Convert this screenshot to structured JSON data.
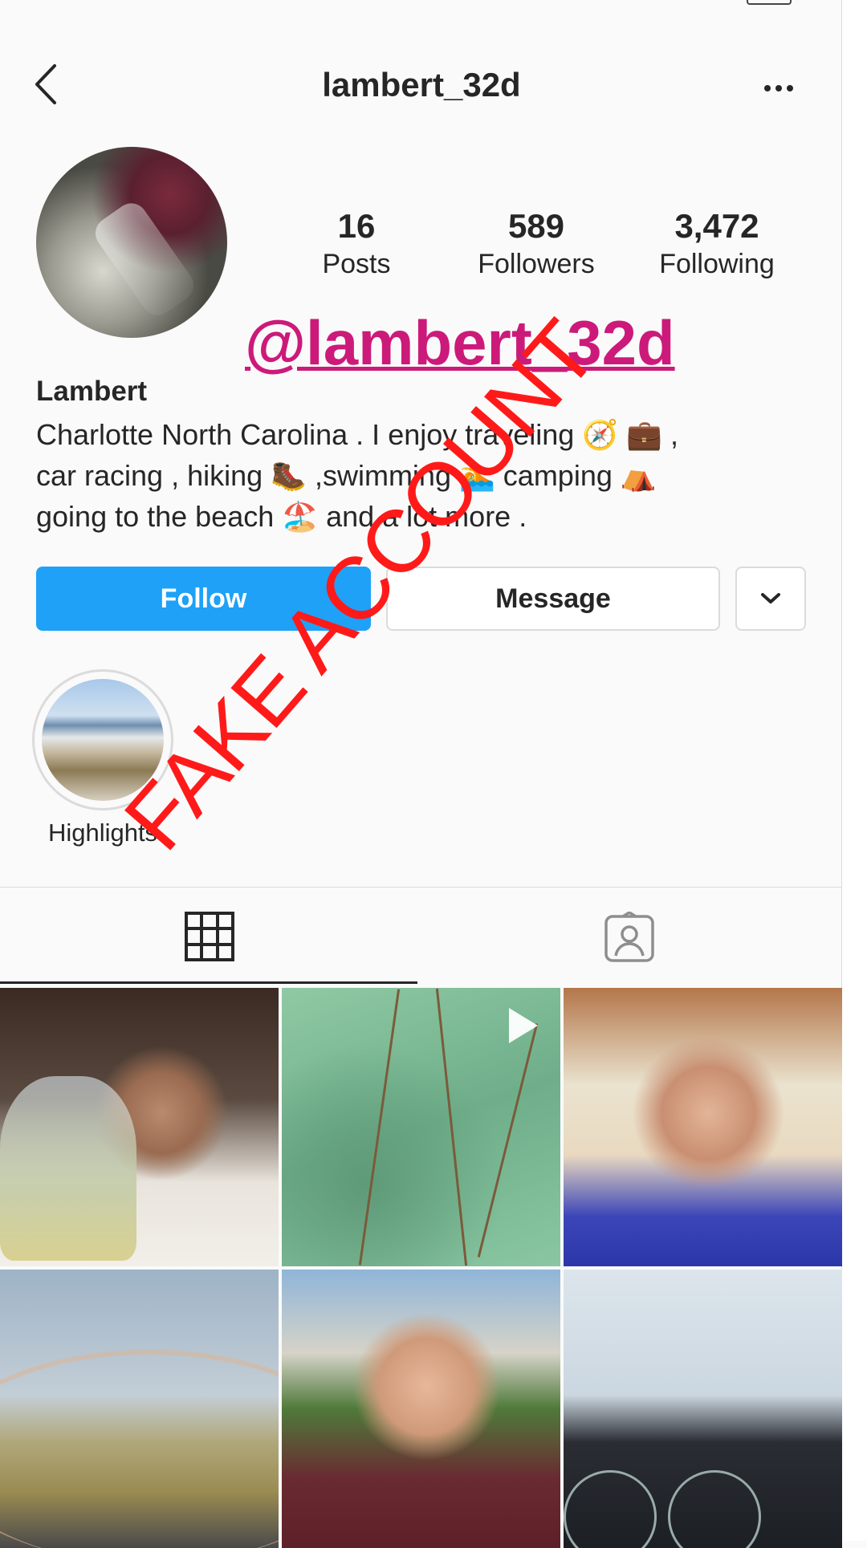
{
  "header": {
    "username": "lambert_32d"
  },
  "profile": {
    "stats": [
      {
        "value": "16",
        "label": "Posts"
      },
      {
        "value": "589",
        "label": "Followers"
      },
      {
        "value": "3,472",
        "label": "Following"
      }
    ],
    "display_name": "Lambert",
    "bio_lines": [
      "Charlotte North Carolina . I enjoy traveling 🧭 💼 ,",
      "car racing , hiking 🥾 ,swimming 🏊 camping ⛺",
      "going to the beach 🏖️ and a lot more ."
    ]
  },
  "overlay": {
    "handle_text": "@lambert_32d",
    "stamp_text": "FAKE ACCOUNT",
    "handle_color": "#cc1a7a",
    "stamp_color": "#ff1a1a"
  },
  "actions": {
    "follow_label": "Follow",
    "message_label": "Message"
  },
  "highlights": [
    {
      "label": "Highlights"
    }
  ],
  "tabs": [
    "grid-icon",
    "tagged-icon"
  ],
  "colors": {
    "accent": "#1ea1f7",
    "text": "#262626",
    "border": "#dbdbdb"
  }
}
